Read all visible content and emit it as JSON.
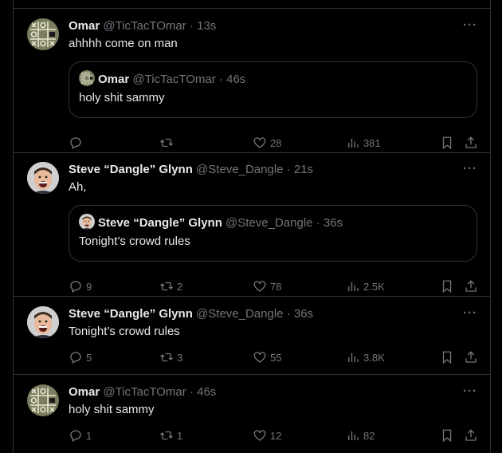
{
  "posts": [
    {
      "name": "Omar",
      "handle": "@TicTacTOmar",
      "time": "13s",
      "text": "ahhhh come on man",
      "quote": {
        "name": "Omar",
        "handle": "@TicTacTOmar",
        "time": "46s",
        "text": "holy shit sammy"
      },
      "replies": "",
      "reposts": "",
      "likes": "28",
      "views": "381"
    },
    {
      "name": "Steve “Dangle” Glynn",
      "handle": "@Steve_Dangle",
      "time": "21s",
      "text": "Ah,",
      "quote": {
        "name": "Steve “Dangle” Glynn",
        "handle": "@Steve_Dangle",
        "time": "36s",
        "text": "Tonight’s crowd rules"
      },
      "replies": "9",
      "reposts": "2",
      "likes": "78",
      "views": "2.5K"
    },
    {
      "name": "Steve “Dangle” Glynn",
      "handle": "@Steve_Dangle",
      "time": "36s",
      "text": "Tonight’s crowd rules",
      "replies": "5",
      "reposts": "3",
      "likes": "55",
      "views": "3.8K"
    },
    {
      "name": "Omar",
      "handle": "@TicTacTOmar",
      "time": "46s",
      "text": "holy shit sammy",
      "replies": "1",
      "reposts": "1",
      "likes": "12",
      "views": "82"
    }
  ],
  "separator": "·",
  "more_label": "···",
  "colors": {
    "background": "#000000",
    "text": "#e7e9ea",
    "muted": "#71767b",
    "border": "#2f3336"
  }
}
